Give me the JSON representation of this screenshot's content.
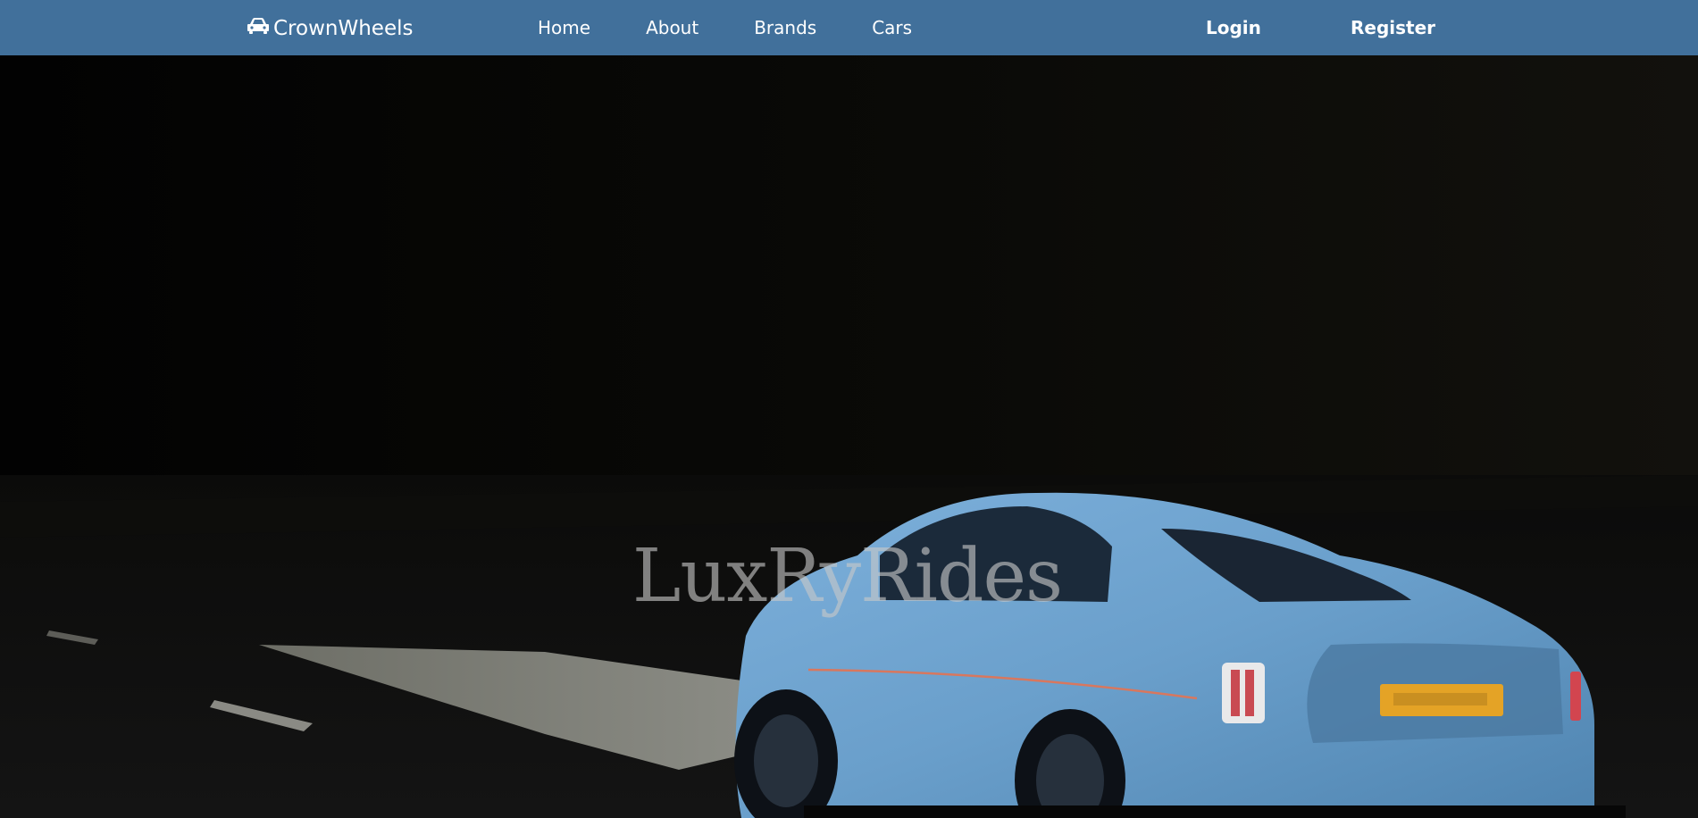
{
  "navbar": {
    "brand": "CrownWheels",
    "brand_icon": "car-icon",
    "links": [
      "Home",
      "About",
      "Brands",
      "Cars"
    ],
    "login": "Login",
    "register": "Register"
  },
  "hero": {
    "title": "LuxRyRides"
  },
  "colors": {
    "navbar": "#41709b",
    "car": "#6a9fcb",
    "background": "#050505"
  }
}
